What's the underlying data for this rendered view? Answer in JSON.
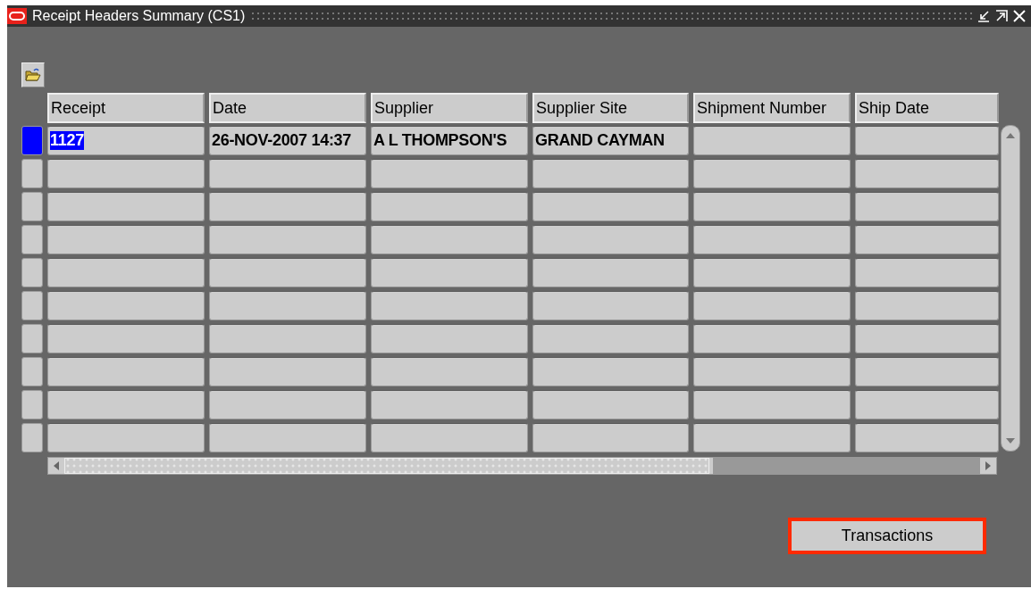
{
  "window": {
    "title": "Receipt Headers Summary (CS1)"
  },
  "table": {
    "columns": [
      "Receipt",
      "Date",
      "Supplier",
      "Supplier Site",
      "Shipment Number",
      "Ship Date"
    ],
    "rows": [
      {
        "selected": true,
        "cells": [
          "1127",
          "26-NOV-2007 14:37",
          "A L THOMPSON'S",
          "GRAND CAYMAN"
        ]
      },
      {
        "selected": false
      },
      {
        "selected": false
      },
      {
        "selected": false
      },
      {
        "selected": false
      },
      {
        "selected": false
      },
      {
        "selected": false
      },
      {
        "selected": false
      },
      {
        "selected": false
      },
      {
        "selected": false
      }
    ]
  },
  "buttons": [
    {
      "label": "Transactions",
      "highlighted": true
    }
  ]
}
